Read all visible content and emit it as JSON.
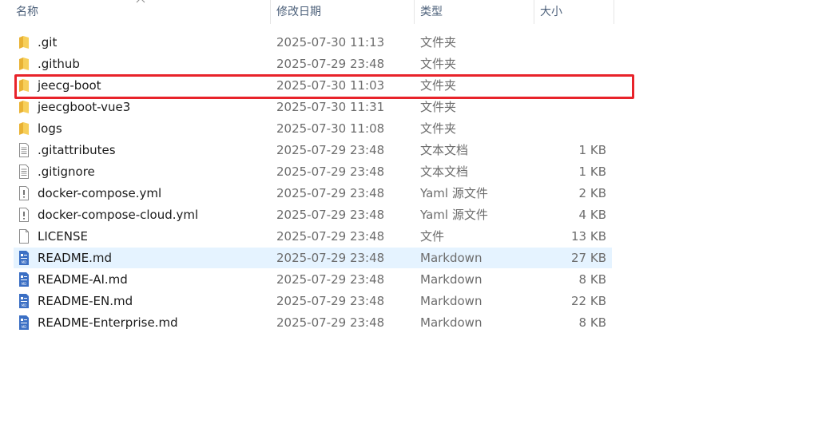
{
  "columns": {
    "name": "名称",
    "date": "修改日期",
    "type": "类型",
    "size": "大小"
  },
  "files": [
    {
      "icon": "folder-icon",
      "name": ".git",
      "date": "2025-07-30 11:13",
      "type": "文件夹",
      "size": ""
    },
    {
      "icon": "folder-icon",
      "name": ".github",
      "date": "2025-07-29 23:48",
      "type": "文件夹",
      "size": ""
    },
    {
      "icon": "folder-icon",
      "name": "jeecg-boot",
      "date": "2025-07-30 11:03",
      "type": "文件夹",
      "size": ""
    },
    {
      "icon": "folder-icon",
      "name": "jeecgboot-vue3",
      "date": "2025-07-30 11:31",
      "type": "文件夹",
      "size": ""
    },
    {
      "icon": "folder-icon",
      "name": "logs",
      "date": "2025-07-30 11:08",
      "type": "文件夹",
      "size": ""
    },
    {
      "icon": "text-file-icon",
      "name": ".gitattributes",
      "date": "2025-07-29 23:48",
      "type": "文本文档",
      "size": "1 KB"
    },
    {
      "icon": "text-file-icon",
      "name": ".gitignore",
      "date": "2025-07-29 23:48",
      "type": "文本文档",
      "size": "1 KB"
    },
    {
      "icon": "yaml-file-icon",
      "name": "docker-compose.yml",
      "date": "2025-07-29 23:48",
      "type": "Yaml 源文件",
      "size": "2 KB"
    },
    {
      "icon": "yaml-file-icon",
      "name": "docker-compose-cloud.yml",
      "date": "2025-07-29 23:48",
      "type": "Yaml 源文件",
      "size": "4 KB"
    },
    {
      "icon": "blank-file-icon",
      "name": "LICENSE",
      "date": "2025-07-29 23:48",
      "type": "文件",
      "size": "13 KB"
    },
    {
      "icon": "markdown-file-icon",
      "name": "README.md",
      "date": "2025-07-29 23:48",
      "type": "Markdown",
      "size": "27 KB"
    },
    {
      "icon": "markdown-file-icon",
      "name": "README-AI.md",
      "date": "2025-07-29 23:48",
      "type": "Markdown",
      "size": "8 KB"
    },
    {
      "icon": "markdown-file-icon",
      "name": "README-EN.md",
      "date": "2025-07-29 23:48",
      "type": "Markdown",
      "size": "22 KB"
    },
    {
      "icon": "markdown-file-icon",
      "name": "README-Enterprise.md",
      "date": "2025-07-29 23:48",
      "type": "Markdown",
      "size": "8 KB"
    }
  ],
  "selected_index": 10,
  "highlighted_index": 2,
  "colors": {
    "selection": "#e5f3ff",
    "highlight_border": "#e8232a",
    "folder": "#f5c447",
    "markdown": "#3b6fc4"
  }
}
